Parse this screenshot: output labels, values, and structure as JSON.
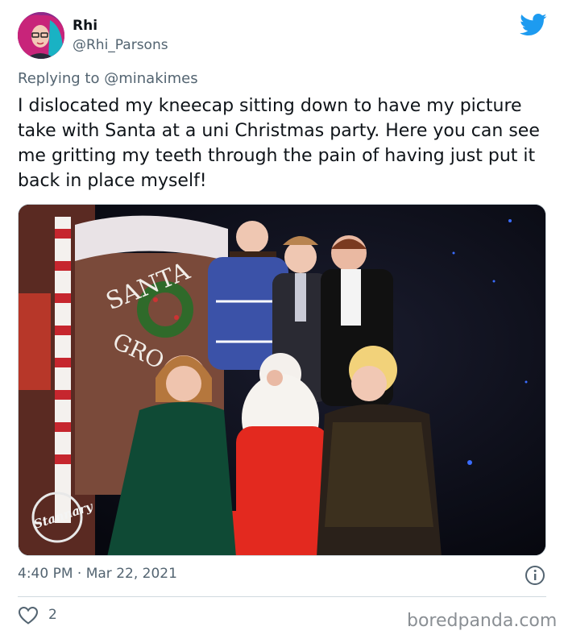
{
  "tweet": {
    "author_name": "Rhi",
    "author_handle": "@Rhi_Parsons",
    "reply_prefix": "Replying to",
    "reply_to": "@minakimes",
    "text": "I dislocated my kneecap sitting down to have my picture take with Santa at a uni Christmas party. Here you can see me gritting my teeth through the pain of having just put it back in place myself!",
    "timestamp": "4:40 PM · Mar 22, 2021",
    "like_count": "2"
  },
  "photo": {
    "sign_text_1": "SANTA",
    "sign_text_2": "GRO",
    "logo_text": "Stannary"
  },
  "watermark": "boredpanda.com",
  "icons": {
    "brand": "twitter-bird-icon",
    "info": "info-icon",
    "like": "heart-icon"
  },
  "colors": {
    "twitter_blue": "#1d9bf0",
    "secondary_text": "#536471",
    "divider": "#cfd9de"
  }
}
